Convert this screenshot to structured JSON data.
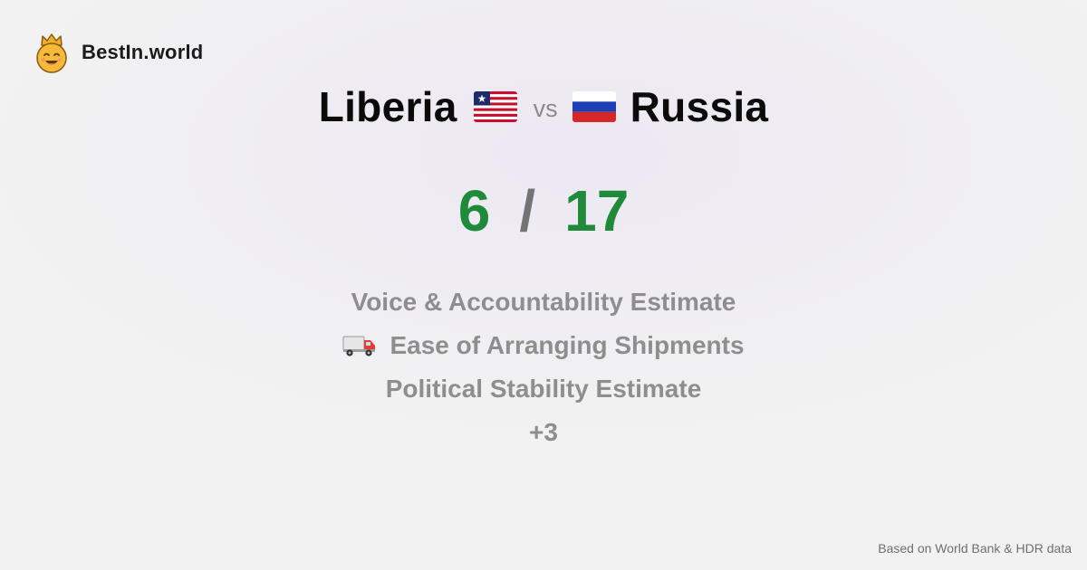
{
  "brand": {
    "name": "BestIn.world",
    "logo_icon": "crowned-smiley-icon"
  },
  "comparison": {
    "left_country": "Liberia",
    "left_flag_icon": "liberia-flag-icon",
    "vs_label": "vs",
    "right_country": "Russia",
    "right_flag_icon": "russia-flag-icon"
  },
  "score": {
    "left": "6",
    "separator": "/",
    "right": "17",
    "color": "#1f8a3a"
  },
  "metrics": [
    {
      "label": "Voice & Accountability Estimate",
      "icon": ""
    },
    {
      "label": "Ease of Arranging Shipments",
      "icon": "delivery-truck-icon"
    },
    {
      "label": "Political Stability Estimate",
      "icon": ""
    },
    {
      "label": "+3",
      "icon": ""
    }
  ],
  "footer": {
    "text": "Based on World Bank & HDR data"
  }
}
